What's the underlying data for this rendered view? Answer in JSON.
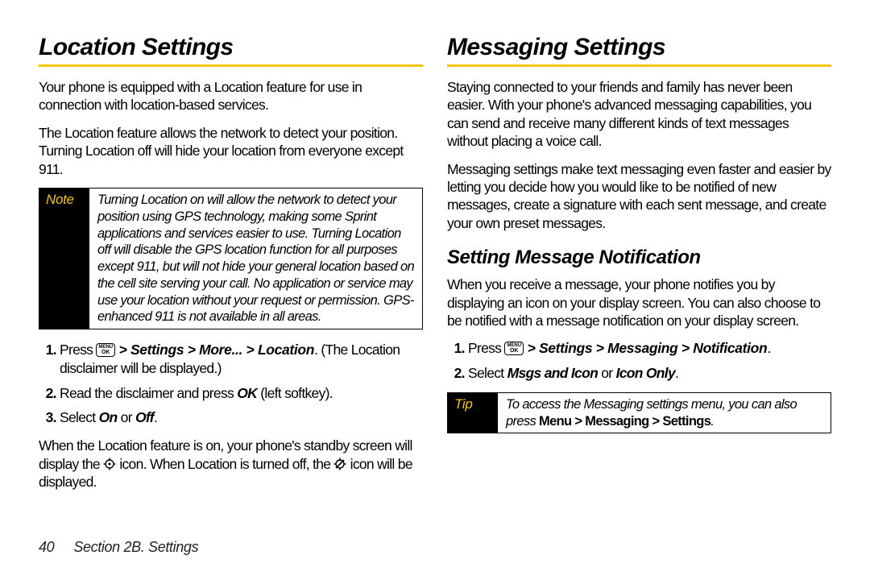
{
  "footer": {
    "page_number": "40",
    "section_label": "Section 2B. Settings"
  },
  "left": {
    "heading": "Location Settings",
    "p1": "Your phone is equipped with a Location feature for use in connection with location-based services.",
    "p2": "The Location feature allows the network to detect your position. Turning Location off will hide your location from everyone except 911.",
    "note_label": "Note",
    "note_body": "Turning Location on will allow the network to detect your position using GPS technology, making some Sprint applications and services easier to use. Turning Location off will disable the GPS location function for all purposes except 911, but will not hide your general location based on the cell site serving your call. No application or service may use your location without your request or permission. GPS-enhanced 911 is not available in all areas.",
    "step1_pre": "Press ",
    "step1_path": " > Settings > More... > Location",
    "step1_post": ". (The Location disclaimer will be displayed.)",
    "step2_a": "Read the disclaimer and press ",
    "step2_ok": "OK",
    "step2_b": " (left softkey).",
    "step3_a": "Select ",
    "step3_on": "On",
    "step3_or": " or ",
    "step3_off": "Off",
    "step3_b": ".",
    "p3_a": "When the Location feature is on, your phone's standby screen will display the ",
    "p3_b": " icon. When Location is turned off, the ",
    "p3_c": " icon will be displayed."
  },
  "right": {
    "heading": "Messaging Settings",
    "p1": "Staying connected to your friends and family has never been easier. With your phone's advanced messaging capabilities, you can send and receive many different kinds of text messages without placing a voice call.",
    "p2": "Messaging settings make text messaging even faster and easier by letting you decide how you would like to be notified of new messages, create a signature with each sent message, and create your own preset messages.",
    "sub1": "Setting Message Notification",
    "p3": "When you receive a message, your phone notifies you by displaying an icon on your display screen. You can also choose to be notified with a message notification on your display screen.",
    "step1_pre": "Press ",
    "step1_path": " > Settings > Messaging > Notification",
    "step1_post": ".",
    "step2_a": "Select ",
    "step2_opt1": "Msgs and Icon",
    "step2_or": " or ",
    "step2_opt2": "Icon Only",
    "step2_b": ".",
    "tip_label": "Tip",
    "tip_a": "To access the Messaging settings menu, you can also press ",
    "tip_path": "Menu > Messaging > Settings",
    "tip_b": "."
  },
  "key": {
    "top": "MENU",
    "bot": "OK"
  }
}
